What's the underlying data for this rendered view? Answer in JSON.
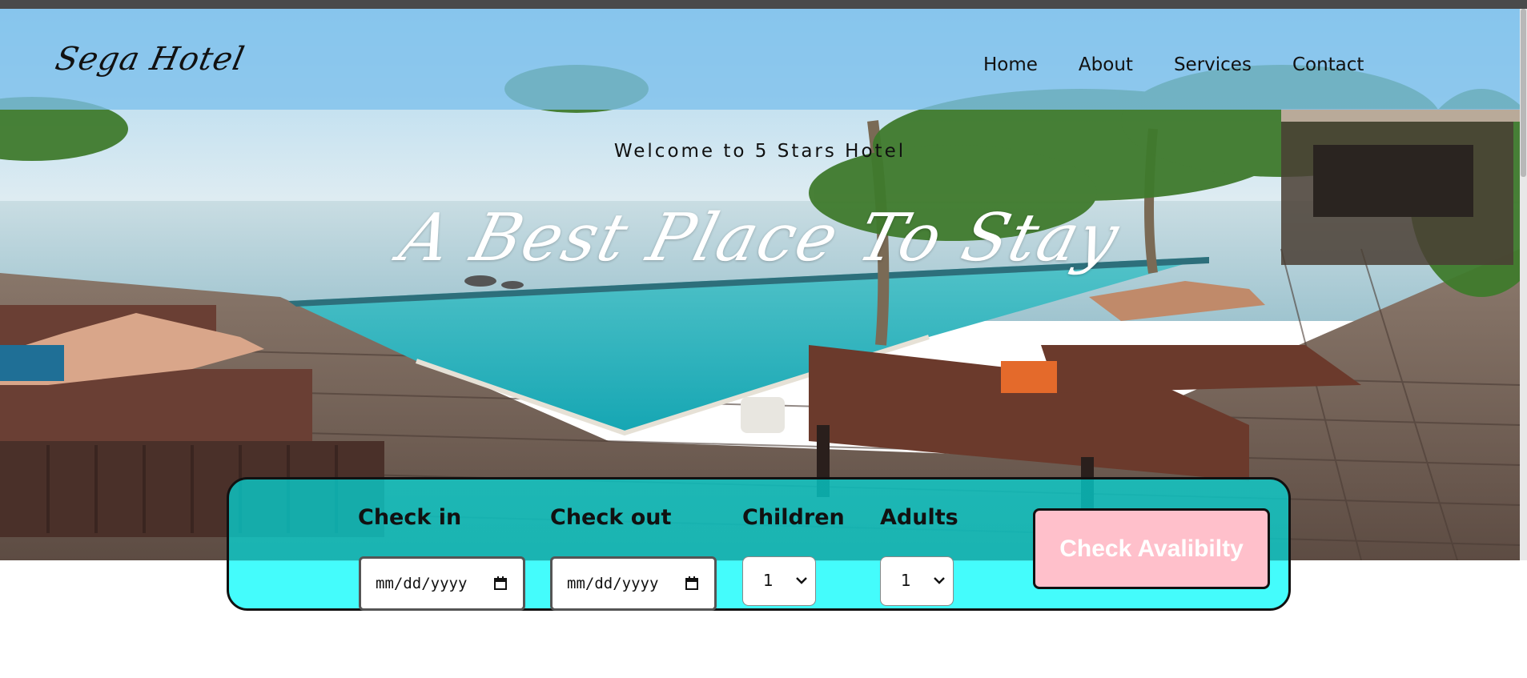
{
  "navbar": {
    "logo": "Sega Hotel",
    "links": [
      "Home",
      "About",
      "Services",
      "Contact"
    ]
  },
  "hero": {
    "welcome": "Welcome to 5 Stars Hotel",
    "tagline": "A Best Place To Stay"
  },
  "booking": {
    "check_in_label": "Check in",
    "check_out_label": "Check out",
    "children_label": "Children",
    "adults_label": "Adults",
    "check_in_placeholder": "mm/dd/yyyy",
    "check_out_placeholder": "mm/dd/yyyy",
    "children_value": "1",
    "adults_value": "1",
    "button_label": "Check Avalibilty"
  },
  "colors": {
    "navbar_bg": "#7ec0ec",
    "booking_bg": "#44fcfc",
    "button_bg": "#ffc0cb"
  }
}
